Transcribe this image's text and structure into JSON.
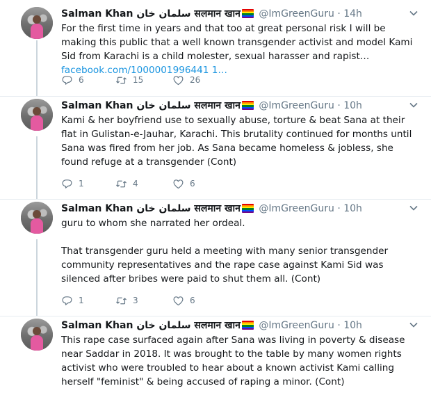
{
  "tweets": [
    {
      "name": "Salman Khan سلمان خان सलमान खान",
      "handle": "@ImGreenGuru",
      "time": "14h",
      "paragraphs": [
        "For the first time in years and that too at great personal risk I will be making this public that a well known transgender activist and model Kami Sid from Karachi is a child molester, sexual harasser and rapist… "
      ],
      "link": "facebook.com/1000001996441 1…",
      "replies": "6",
      "retweets": "15",
      "likes": "26"
    },
    {
      "name": "Salman Khan سلمان خان सलमान खान",
      "handle": "@ImGreenGuru",
      "time": "10h",
      "paragraphs": [
        "Kami & her boyfriend use to sexually abuse, torture & beat Sana at their flat in Gulistan-e-Jauhar, Karachi. This brutality continued for months until Sana was fired from her job. As Sana became homeless & jobless, she found refuge at a transgender (Cont)"
      ],
      "link": "",
      "replies": "1",
      "retweets": "4",
      "likes": "6"
    },
    {
      "name": "Salman Khan سلمان خان सलमान खान",
      "handle": "@ImGreenGuru",
      "time": "10h",
      "paragraphs": [
        "guru to whom she narrated her ordeal.",
        "That transgender guru held a meeting with many senior transgender community representatives and the rape case against Kami Sid was silenced after bribes were paid to shut them all. (Cont)"
      ],
      "link": "",
      "replies": "1",
      "retweets": "3",
      "likes": "6"
    },
    {
      "name": "Salman Khan سلمان خان सलमान खान",
      "handle": "@ImGreenGuru",
      "time": "10h",
      "paragraphs": [
        "This rape case surfaced again after Sana was living in poverty & disease near Saddar in 2018. It was brought to the table by many women rights activist who were troubled to hear about a known activist Kami calling herself \"feminist\" & being accused of raping a minor. (Cont)"
      ],
      "link": "",
      "replies": "",
      "retweets": "",
      "likes": ""
    }
  ],
  "icons": {
    "reply": "reply-icon",
    "retweet": "retweet-icon",
    "like": "heart-icon",
    "menu": "chevron-down-icon",
    "flag": "rainbow-flag-icon"
  },
  "colors": {
    "link": "#1b95e0",
    "muted": "#657786",
    "text": "#14171a",
    "thread": "#ccd6dd"
  }
}
